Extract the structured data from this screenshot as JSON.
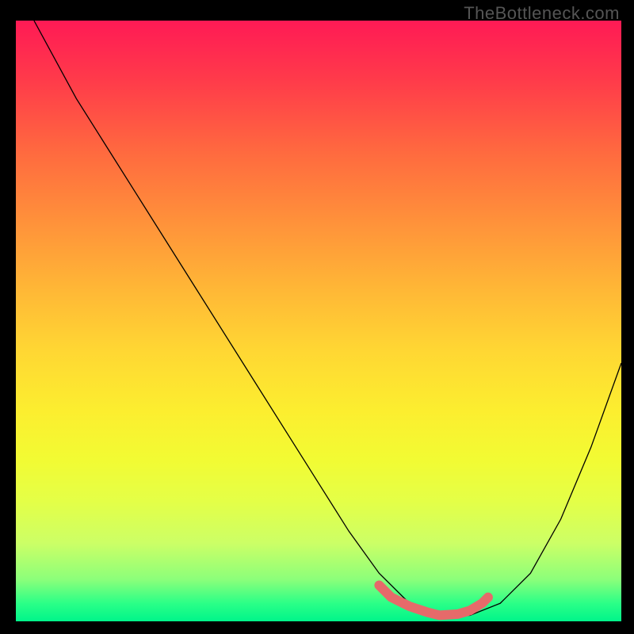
{
  "watermark": "TheBottleneck.com",
  "chart_data": {
    "type": "line",
    "title": "",
    "xlabel": "",
    "ylabel": "",
    "xlim": [
      0,
      100
    ],
    "ylim": [
      0,
      100
    ],
    "series": [
      {
        "name": "curve",
        "x": [
          3,
          10,
          20,
          30,
          40,
          50,
          55,
          60,
          65,
          70,
          75,
          80,
          85,
          90,
          95,
          100
        ],
        "y": [
          100,
          87,
          71,
          55,
          39,
          23,
          15,
          8,
          3,
          1,
          1,
          3,
          8,
          17,
          29,
          43
        ]
      },
      {
        "name": "highlight",
        "x": [
          60,
          62,
          65,
          68,
          70,
          73,
          75,
          77,
          78
        ],
        "y": [
          6,
          4,
          2.5,
          1.5,
          1,
          1.2,
          1.8,
          3,
          4
        ]
      }
    ],
    "colors": {
      "curve": "#000000",
      "highlight": "#e66a6a",
      "gradient_top": "#ff1a55",
      "gradient_bottom": "#00f58a"
    }
  }
}
